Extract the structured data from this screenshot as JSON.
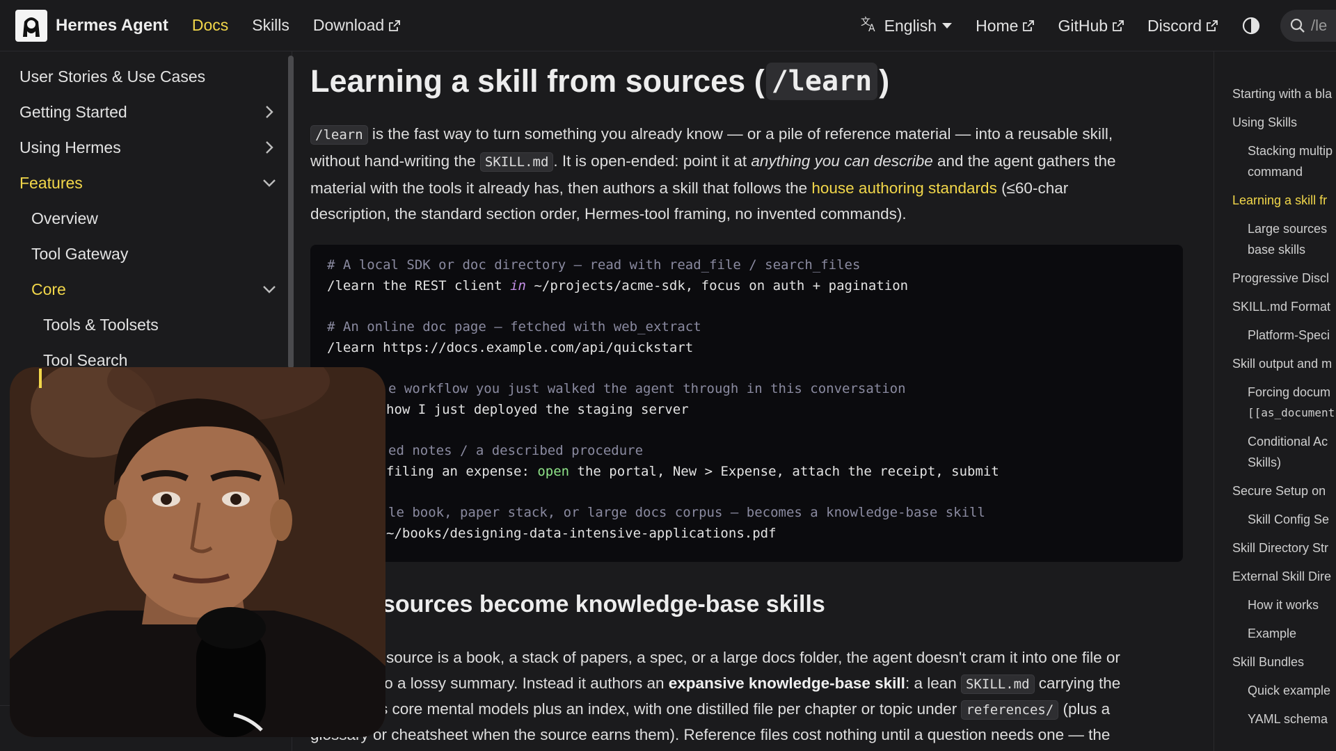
{
  "navbar": {
    "brand": "Hermes Agent",
    "links": [
      "Docs",
      "Skills",
      "Download"
    ],
    "language": "English",
    "right_links": [
      "Home",
      "GitHub",
      "Discord"
    ],
    "search_placeholder": "/le"
  },
  "sidebar": {
    "items": [
      {
        "label": "User Stories & Use Cases"
      },
      {
        "label": "Getting Started"
      },
      {
        "label": "Using Hermes"
      },
      {
        "label": "Features"
      },
      {
        "label": "Overview"
      },
      {
        "label": "Tool Gateway"
      },
      {
        "label": "Core"
      },
      {
        "label": "Tools & Toolsets"
      },
      {
        "label": "Tool Search"
      }
    ]
  },
  "main": {
    "title_prefix": "Learning a skill from sources (",
    "title_code": "/learn",
    "title_suffix": ")",
    "p1": {
      "code1": "/learn",
      "t1": " is the fast way to turn something you already know — or a pile of reference material — into a reusable skill,",
      "t2": "without hand-writing the ",
      "code2": "SKILL.md",
      "t3": ". It is open-ended: point it at ",
      "em": "anything you can describe",
      "t4": " and the agent gathers the",
      "t5": "material with the tools it already has, then authors a skill that follows the ",
      "link": "house authoring standards",
      "t6": " (≤60-char",
      "t7": "description, the standard section order, Hermes-tool framing, no invented commands)."
    },
    "code": {
      "c1": "# A local SDK or doc directory — read with read_file / search_files",
      "l1a": "/learn the REST client ",
      "l1kw": "in",
      "l1b": " ~/projects/acme-sdk, focus on auth + pagination",
      "c2": "# An online doc page — fetched with web_extract",
      "l2": "/learn https://docs.example.com/api/quickstart",
      "c3": "e workflow you just walked the agent through in this conversation",
      "l3": "how I just deployed the staging server",
      "c4": "ed notes / a described procedure",
      "l4a": "filing an expense: ",
      "l4kw": "open",
      "l4b": " the portal, New > Expense, attach the receipt, submit",
      "c5": "le book, paper stack, or large docs corpus — becomes a knowledge-base skill",
      "l5": "~/books/designing-data-intensive-applications.pdf"
    },
    "h2": "sources become knowledge-base skills",
    "p2": {
      "line1": "source is a book, a stack of papers, a spec, or a large docs folder, the agent doesn't cram it into one file or",
      "l2a": "to a lossy summary. Instead it authors an ",
      "l2b": "expansive knowledge-base skill",
      "l2c": ": a lean ",
      "l2code": "SKILL.md",
      "l2d": " carrying the",
      "l3a": "s core mental models plus an index, with one distilled file per chapter or topic under ",
      "l3code": "references/",
      "l3b": " (plus a",
      "line4": "glossary or cheatsheet when the source earns them). Reference files cost nothing until a question needs one — the"
    }
  },
  "toc": {
    "items": [
      {
        "label": "Starting with a bla"
      },
      {
        "label": "Using Skills"
      },
      {
        "label": "Stacking multip"
      },
      {
        "label": "command"
      },
      {
        "label": "Learning a skill fr"
      },
      {
        "label": "Large sources"
      },
      {
        "label": "base skills"
      },
      {
        "label": "Progressive Discl"
      },
      {
        "label": "SKILL.md Format"
      },
      {
        "label": "Platform-Speci"
      },
      {
        "label": "Skill output and m"
      },
      {
        "label": "Forcing docum"
      },
      {
        "label": "[[as_document"
      },
      {
        "label": "Conditional Ac"
      },
      {
        "label": "Skills)"
      },
      {
        "label": "Secure Setup on"
      },
      {
        "label": "Skill Config Se"
      },
      {
        "label": "Skill Directory Str"
      },
      {
        "label": "External Skill Dire"
      },
      {
        "label": "How it works"
      },
      {
        "label": "Example"
      },
      {
        "label": "Skill Bundles"
      },
      {
        "label": "Quick example"
      },
      {
        "label": "YAML schema"
      }
    ]
  },
  "colors": {
    "accent": "#f2d74a",
    "background": "#1b1b1d",
    "code_background": "#0b0b0e"
  }
}
